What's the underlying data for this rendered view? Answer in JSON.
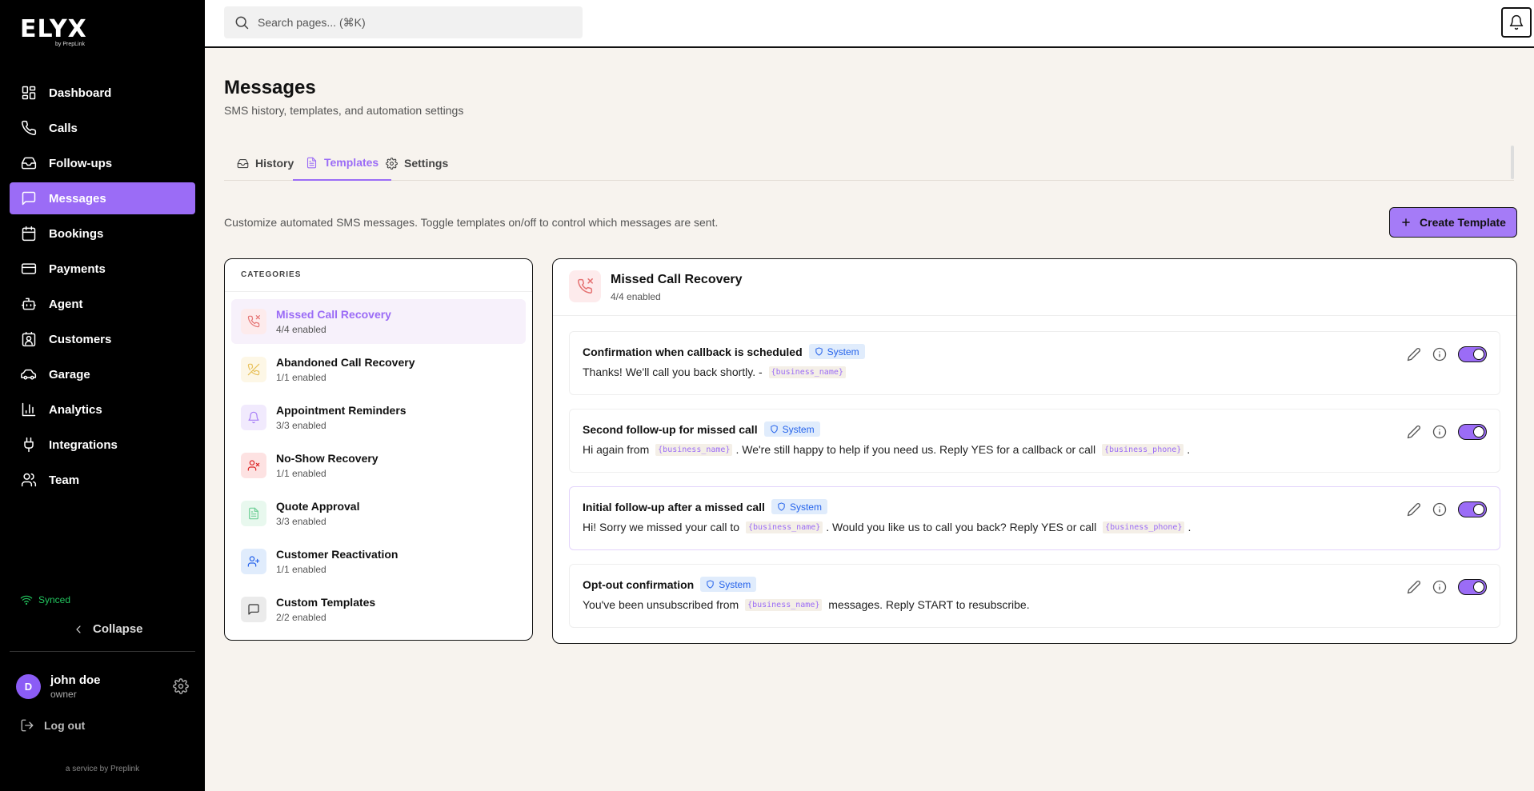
{
  "brand": {
    "logo": "ELYX",
    "sub": "by PrepLink"
  },
  "search": {
    "placeholder": "Search pages... (⌘K)"
  },
  "nav": [
    {
      "label": "Dashboard",
      "icon": "dashboard-icon"
    },
    {
      "label": "Calls",
      "icon": "phone-icon"
    },
    {
      "label": "Follow-ups",
      "icon": "inbox-icon"
    },
    {
      "label": "Messages",
      "icon": "message-icon",
      "active": true
    },
    {
      "label": "Bookings",
      "icon": "calendar-icon"
    },
    {
      "label": "Payments",
      "icon": "credit-card-icon"
    },
    {
      "label": "Agent",
      "icon": "bot-icon"
    },
    {
      "label": "Customers",
      "icon": "contact-icon"
    },
    {
      "label": "Garage",
      "icon": "car-icon"
    },
    {
      "label": "Analytics",
      "icon": "bar-chart-icon"
    },
    {
      "label": "Integrations",
      "icon": "plug-icon"
    },
    {
      "label": "Team",
      "icon": "users-icon"
    }
  ],
  "sidebar_footer": {
    "status": "Synced",
    "collapse": "Collapse",
    "user_initial": "D",
    "user_name": "john doe",
    "user_role": "owner",
    "logout": "Log out",
    "service": "a service by Preplink"
  },
  "page": {
    "title": "Messages",
    "subtitle": "SMS history, templates, and automation settings",
    "tabs": [
      {
        "label": "History",
        "icon": "inbox-icon"
      },
      {
        "label": "Templates",
        "icon": "file-text-icon",
        "active": true
      },
      {
        "label": "Settings",
        "icon": "gear-icon"
      }
    ],
    "description": "Customize automated SMS messages. Toggle templates on/off to control which messages are sent.",
    "create_button": "Create Template"
  },
  "categories": {
    "heading": "CATEGORIES",
    "items": [
      {
        "name": "Missed Call Recovery",
        "count": "4/4 enabled",
        "icon": "phone-missed-icon",
        "color": "#e57373",
        "bg": "#fdebec",
        "active": true
      },
      {
        "name": "Abandoned Call Recovery",
        "count": "1/1 enabled",
        "icon": "phone-off-icon",
        "color": "#e8c15a",
        "bg": "#fdf7e6"
      },
      {
        "name": "Appointment Reminders",
        "count": "3/3 enabled",
        "icon": "bell-icon",
        "color": "#a57bf7",
        "bg": "#f1eafd"
      },
      {
        "name": "No-Show Recovery",
        "count": "1/1 enabled",
        "icon": "user-x-icon",
        "color": "#dc2626",
        "bg": "#fde2e2"
      },
      {
        "name": "Quote Approval",
        "count": "3/3 enabled",
        "icon": "file-text-icon",
        "color": "#6fcf97",
        "bg": "#e8f8ee"
      },
      {
        "name": "Customer Reactivation",
        "count": "1/1 enabled",
        "icon": "user-plus-icon",
        "color": "#2563eb",
        "bg": "#e0ecfc"
      },
      {
        "name": "Custom Templates",
        "count": "2/2 enabled",
        "icon": "message-square-icon",
        "color": "#333333",
        "bg": "#ebebeb"
      }
    ]
  },
  "templates": {
    "title": "Missed Call Recovery",
    "count": "4/4 enabled",
    "badge": "System",
    "items": [
      {
        "title": "Confirmation when callback is scheduled",
        "body": [
          {
            "t": "Thanks! We'll call you back shortly. - "
          },
          {
            "v": "{business_name}"
          }
        ],
        "enabled": true
      },
      {
        "title": "Second follow-up for missed call",
        "body": [
          {
            "t": "Hi again from "
          },
          {
            "v": "{business_name}"
          },
          {
            "t": ". We're still happy to help if you need us. Reply YES for a callback or call "
          },
          {
            "v": "{business_phone}"
          },
          {
            "t": "."
          }
        ],
        "enabled": true
      },
      {
        "title": "Initial follow-up after a missed call",
        "body": [
          {
            "t": "Hi! Sorry we missed your call to "
          },
          {
            "v": "{business_name}"
          },
          {
            "t": ". Would you like us to call you back? Reply YES or call "
          },
          {
            "v": "{business_phone}"
          },
          {
            "t": "."
          }
        ],
        "enabled": true,
        "highlight": true
      },
      {
        "title": "Opt-out confirmation",
        "body": [
          {
            "t": "You've been unsubscribed from "
          },
          {
            "v": "{business_name}"
          },
          {
            "t": " messages. Reply START to resubscribe."
          }
        ],
        "enabled": true
      }
    ]
  },
  "colors": {
    "accent": "#9b6cf6",
    "sidebar": "#000000",
    "background": "#f7f3ee",
    "synced": "#22c55e",
    "badge": "#2563eb"
  }
}
